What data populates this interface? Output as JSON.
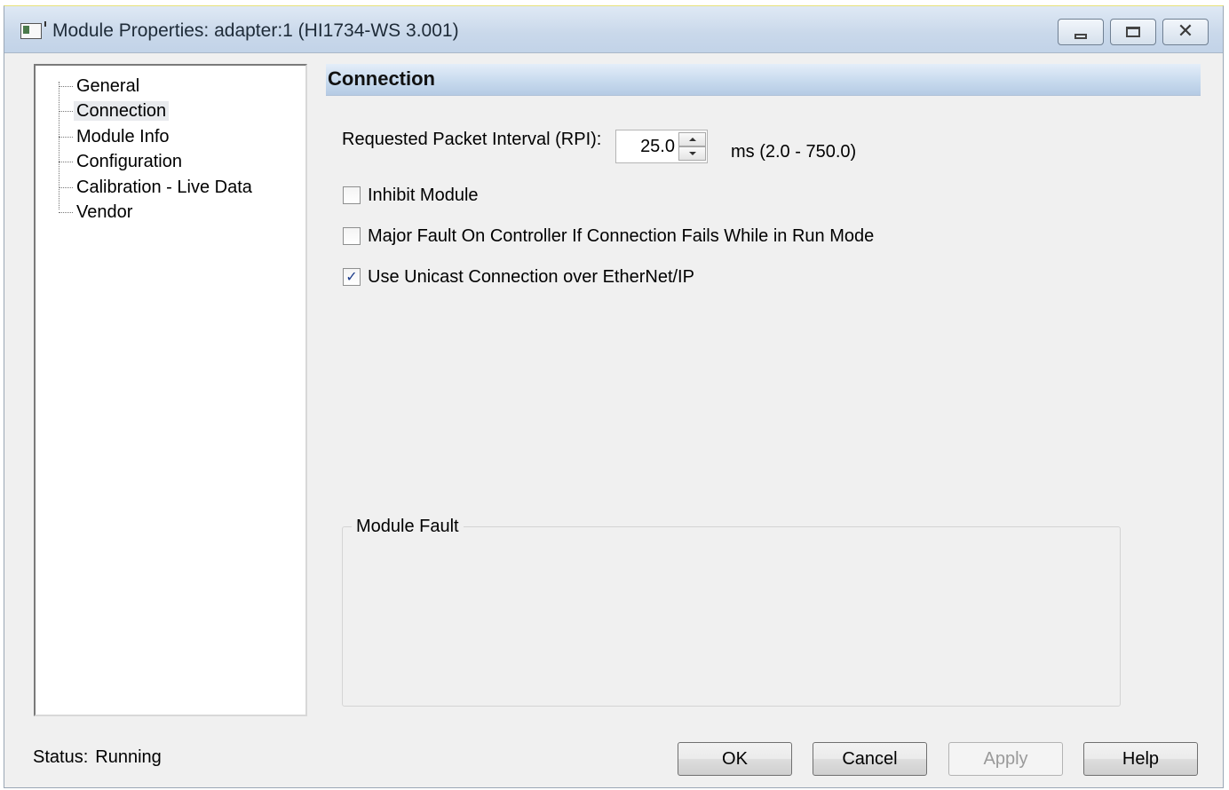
{
  "window": {
    "title": "Module Properties: adapter:1 (HI1734-WS 3.001)"
  },
  "tree": {
    "items": [
      {
        "label": "General"
      },
      {
        "label": "Connection"
      },
      {
        "label": "Module Info"
      },
      {
        "label": "Configuration"
      },
      {
        "label": "Calibration - Live Data"
      },
      {
        "label": "Vendor"
      }
    ],
    "selected": "Connection"
  },
  "section": {
    "title": "Connection"
  },
  "rpi": {
    "label": "Requested Packet Interval (RPI):",
    "value": "25.0",
    "range": "ms (2.0 - 750.0)"
  },
  "options": {
    "inhibit_module": {
      "label": "Inhibit Module",
      "checked": false
    },
    "major_fault": {
      "label": "Major Fault On Controller If Connection Fails While in Run Mode",
      "checked": false
    },
    "unicast": {
      "label": "Use Unicast Connection over EtherNet/IP",
      "checked": true
    }
  },
  "module_fault": {
    "label": "Module Fault"
  },
  "status": {
    "label": "Status:",
    "value": "Running"
  },
  "buttons": {
    "ok": "OK",
    "cancel": "Cancel",
    "apply": "Apply",
    "help": "Help"
  },
  "colors": {
    "header_gradient": "#c8daee",
    "check_color": "#1b3b8a",
    "disabled_text": "#9a9a9a"
  }
}
